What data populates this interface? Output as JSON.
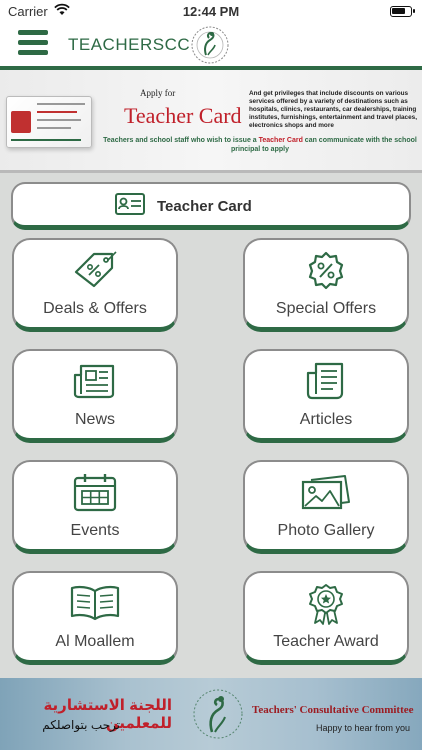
{
  "status_bar": {
    "carrier": "Carrier",
    "time": "12:44 PM"
  },
  "nav": {
    "title": "TEACHERSCC",
    "menu_icon": "hamburger-menu-icon",
    "logo_icon": "tcc-logo-icon"
  },
  "banner": {
    "apply_for": "Apply for",
    "title": "Teacher Card",
    "description": "And get privileges that include discounts on various services offered by a variety of destinations such as hospitals, clinics, restaurants, car dealerships, training institutes, furnishings, entertainment and travel places, electronics shops and more",
    "note_before": "Teachers and school staff who wish to issue a ",
    "note_highlight": "Teacher Card",
    "note_after": " can communicate with the school principal to apply"
  },
  "teacher_card_button": {
    "label": "Teacher Card",
    "icon": "id-card-icon"
  },
  "tiles": [
    {
      "label": "Deals & Offers",
      "icon": "discount-tag-icon"
    },
    {
      "label": "Special Offers",
      "icon": "discount-badge-icon"
    },
    {
      "label": "News",
      "icon": "newspaper-icon"
    },
    {
      "label": "Articles",
      "icon": "article-icon"
    },
    {
      "label": "Events",
      "icon": "calendar-icon"
    },
    {
      "label": "Photo Gallery",
      "icon": "photo-gallery-icon"
    },
    {
      "label": "Al Moallem",
      "icon": "open-book-icon"
    },
    {
      "label": "Teacher Award",
      "icon": "award-ribbon-icon"
    }
  ],
  "footer": {
    "arabic_title": "اللجنة الاستشارية للمعلمين",
    "arabic_subtitle": "ترحب بتواصلكم",
    "english_title": "Teachers' Consultative Committee",
    "english_subtitle": "Happy to hear from you"
  },
  "colors": {
    "brand_green": "#2e6a45",
    "accent_red": "#c0202a",
    "background": "#d9dbd9"
  }
}
